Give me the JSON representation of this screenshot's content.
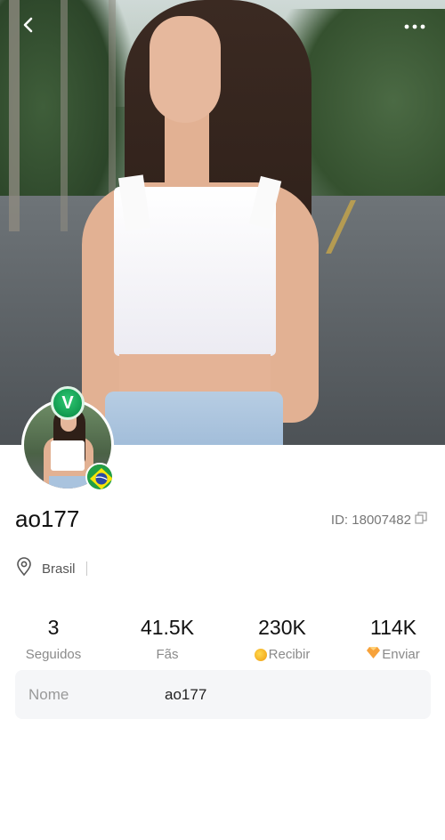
{
  "header": {
    "back_icon": "chevron-left-icon",
    "more_icon": "more-horizontal-icon"
  },
  "profile": {
    "username": "ao177",
    "id_text": "ID: 18007482",
    "location": "Brasil",
    "badge_letter": "V"
  },
  "stats": [
    {
      "value": "3",
      "label": "Seguidos"
    },
    {
      "value": "41.5K",
      "label": "Fãs"
    },
    {
      "value": "230K",
      "label": "Recibir"
    },
    {
      "value": "114K",
      "label": "Enviar"
    }
  ],
  "info": {
    "name_key": "Nome",
    "name_value": "ao177"
  },
  "colors": {
    "vip_green": "#119a50",
    "coin_gold": "#f2a81d",
    "gem_orange": "#f7a23a"
  }
}
